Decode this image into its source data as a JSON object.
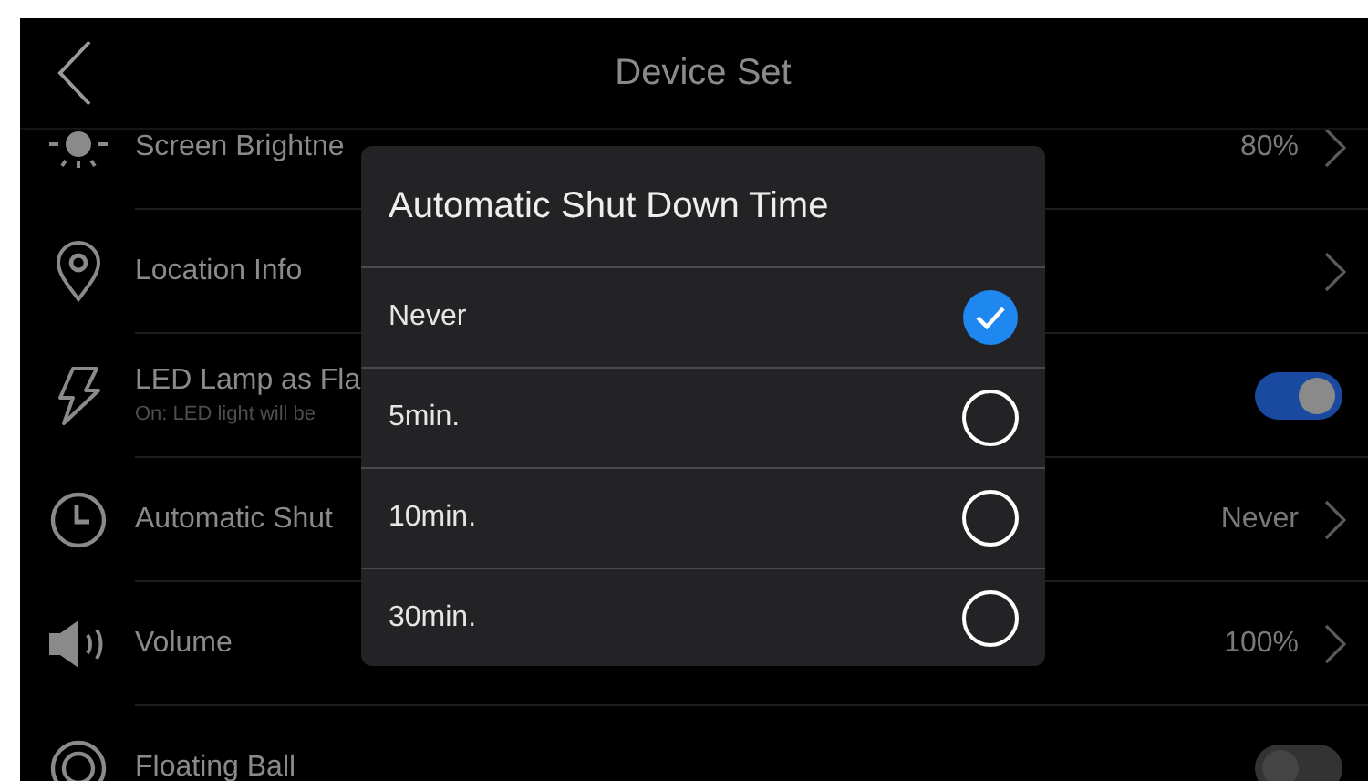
{
  "header": {
    "title": "Device Set"
  },
  "settings": [
    {
      "kind": "value",
      "label": "Screen Brightne",
      "value": "80%"
    },
    {
      "kind": "chevron",
      "label": "Location Info"
    },
    {
      "kind": "toggle",
      "label": "LED Lamp as Fla",
      "sublabel": "On: LED light will be",
      "on": true
    },
    {
      "kind": "value",
      "label": "Automatic Shut",
      "value": "Never"
    },
    {
      "kind": "value",
      "label": "Volume",
      "value": "100%"
    },
    {
      "kind": "toggle",
      "label": "Floating Ball",
      "on": false
    }
  ],
  "dialog": {
    "title": "Automatic Shut Down Time",
    "options": [
      {
        "label": "Never",
        "selected": true
      },
      {
        "label": "5min.",
        "selected": false
      },
      {
        "label": "10min.",
        "selected": false
      },
      {
        "label": "30min.",
        "selected": false
      }
    ]
  }
}
